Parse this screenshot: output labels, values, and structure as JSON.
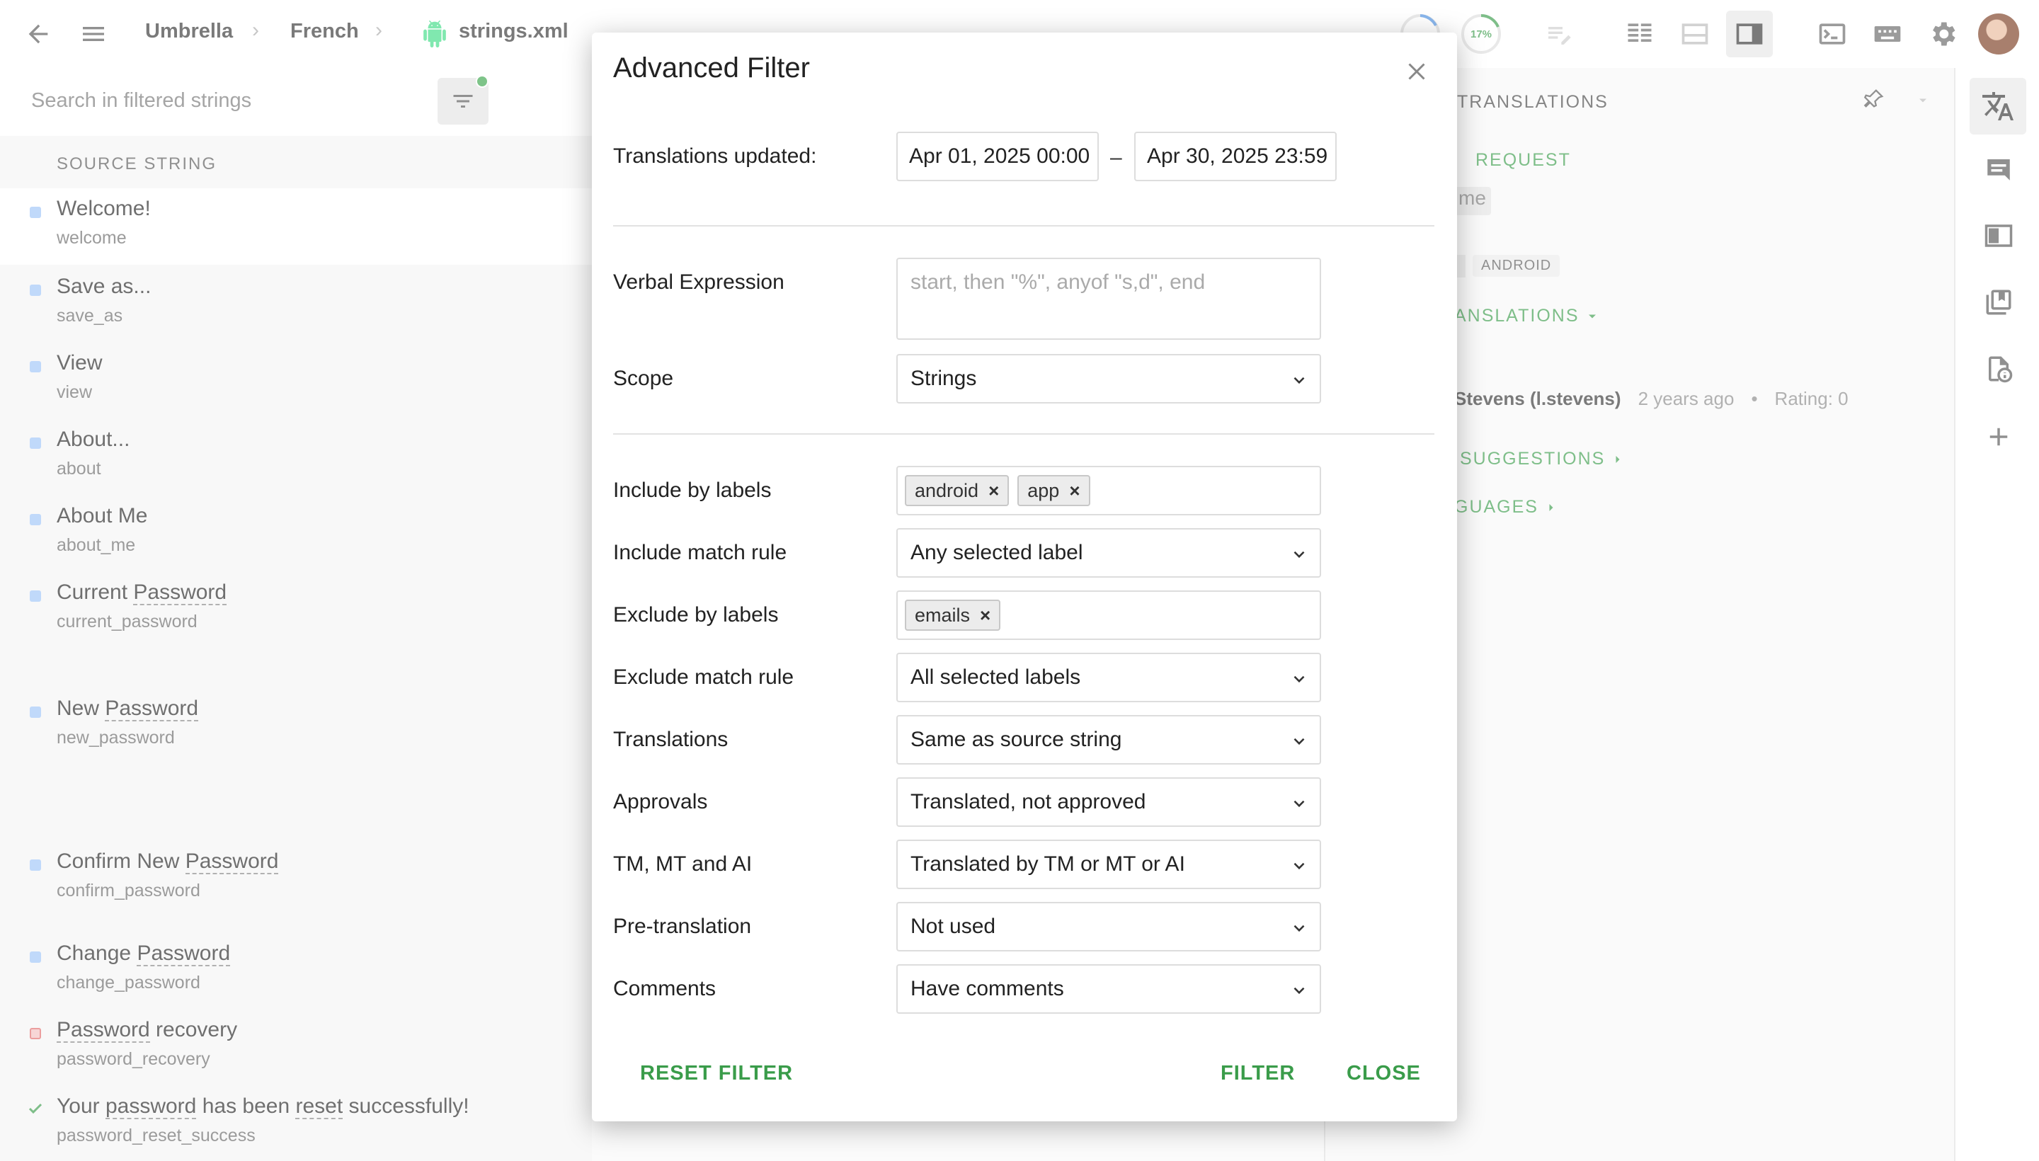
{
  "breadcrumb": {
    "project": "Umbrella",
    "language": "French",
    "file": "strings.xml"
  },
  "progress": {
    "translated_percent": 17,
    "translated_label": "17%"
  },
  "search": {
    "placeholder": "Search in filtered strings"
  },
  "list": {
    "header": "SOURCE STRING",
    "items": [
      {
        "title": "Welcome!",
        "key": "welcome",
        "status": "untranslated"
      },
      {
        "title": "Save as...",
        "key": "save_as",
        "status": "untranslated"
      },
      {
        "title": "View",
        "key": "view",
        "status": "untranslated"
      },
      {
        "title": "About...",
        "key": "about",
        "status": "untranslated"
      },
      {
        "title": "About Me",
        "key": "about_me",
        "status": "untranslated"
      },
      {
        "title_pre": "Current ",
        "title_term": "Password",
        "key": "current_password",
        "status": "untranslated"
      },
      {
        "title_pre": "New ",
        "title_term": "Password",
        "key": "new_password",
        "status": "untranslated"
      },
      {
        "title_pre": "Confirm New ",
        "title_term": "Password",
        "key": "confirm_password",
        "status": "untranslated"
      },
      {
        "title_pre": "Change ",
        "title_term": "Password",
        "key": "change_password",
        "status": "untranslated"
      },
      {
        "title_term": "Password",
        "title_post": " recovery",
        "key": "password_recovery",
        "status": "error"
      },
      {
        "title_pre": "Your ",
        "title_term": "password",
        "title_mid": " has been ",
        "title_term2": "reset",
        "title_post": " successfully!",
        "key": "password_reset_success",
        "status": "approved"
      }
    ]
  },
  "right_panel": {
    "translations_header": "TRANSLATIONS",
    "request": "REQUEST",
    "partial_value": "me",
    "badge": "ANDROID",
    "translations_toggle": "ANSLATIONS",
    "author": "Stevens (l.stevens)",
    "time": "2 years ago",
    "rating": "Rating: 0",
    "suggestions": "SUGGESTIONS",
    "languages": "GUAGES"
  },
  "modal": {
    "title": "Advanced Filter",
    "translations_updated_label": "Translations updated:",
    "date_from": "Apr 01, 2025 00:00",
    "date_sep": "–",
    "date_to": "Apr 30, 2025 23:59",
    "verbal_label": "Verbal Expression",
    "verbal_placeholder": "start, then \"%\", anyof \"s,d\", end",
    "scope_label": "Scope",
    "scope_value": "Strings",
    "include_labels_label": "Include by labels",
    "include_labels": [
      "android",
      "app"
    ],
    "include_rule_label": "Include match rule",
    "include_rule_value": "Any selected label",
    "exclude_labels_label": "Exclude by labels",
    "exclude_labels": [
      "emails"
    ],
    "exclude_rule_label": "Exclude match rule",
    "exclude_rule_value": "All selected labels",
    "translations_label": "Translations",
    "translations_value": "Same as source string",
    "approvals_label": "Approvals",
    "approvals_value": "Translated, not approved",
    "tm_label": "TM, MT and AI",
    "tm_value": "Translated by TM or MT or AI",
    "pretranslation_label": "Pre-translation",
    "pretranslation_value": "Not used",
    "comments_label": "Comments",
    "comments_value": "Have comments",
    "reset_btn": "RESET FILTER",
    "filter_btn": "FILTER",
    "close_btn": "CLOSE"
  },
  "colors": {
    "accent": "#3a9c4a",
    "untranslated": "#9ec5f8",
    "error": "#e06a6a"
  }
}
